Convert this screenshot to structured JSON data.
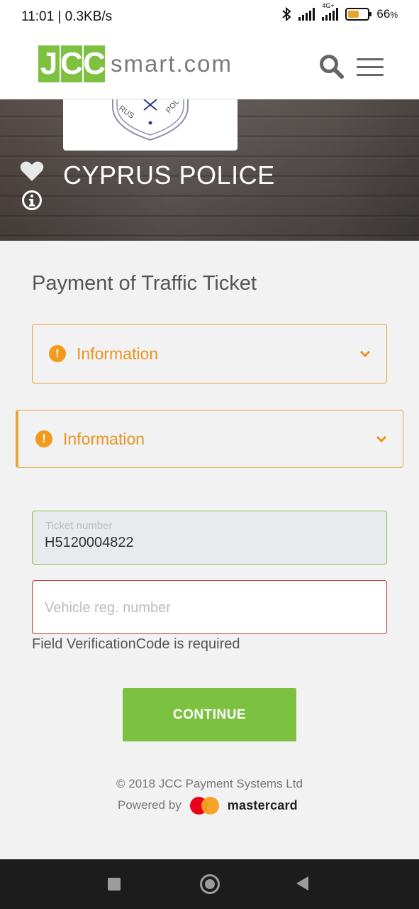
{
  "status_bar": {
    "time": "11:01 | 0.3KB/s",
    "network": "4G+",
    "battery": "66",
    "battery_unit": "%",
    "battery_level": 0.66
  },
  "header": {
    "logo": [
      "J",
      "C",
      "C"
    ],
    "logo_suffix": "smart.com"
  },
  "hero": {
    "title": "CYPRUS POLICE"
  },
  "main": {
    "page_title": "Payment of Traffic Ticket",
    "accordions": [
      {
        "label": "Information",
        "icon": "!"
      },
      {
        "label": "Information",
        "icon": "!"
      }
    ],
    "ticket_field": {
      "label": "Ticket number",
      "value": "H5120004822"
    },
    "vehicle_field": {
      "placeholder": "Vehicle reg. number",
      "value": ""
    },
    "error": "Field VerificationCode is required",
    "continue_label": "CONTINUE"
  },
  "footer": {
    "copyright": "© 2018 JCC Payment Systems Ltd",
    "powered_by": "Powered by",
    "mastercard": "mastercard"
  },
  "colors": {
    "brand_green": "#7ec03f",
    "warning_orange": "#e99422",
    "error_red": "#c0392b"
  }
}
